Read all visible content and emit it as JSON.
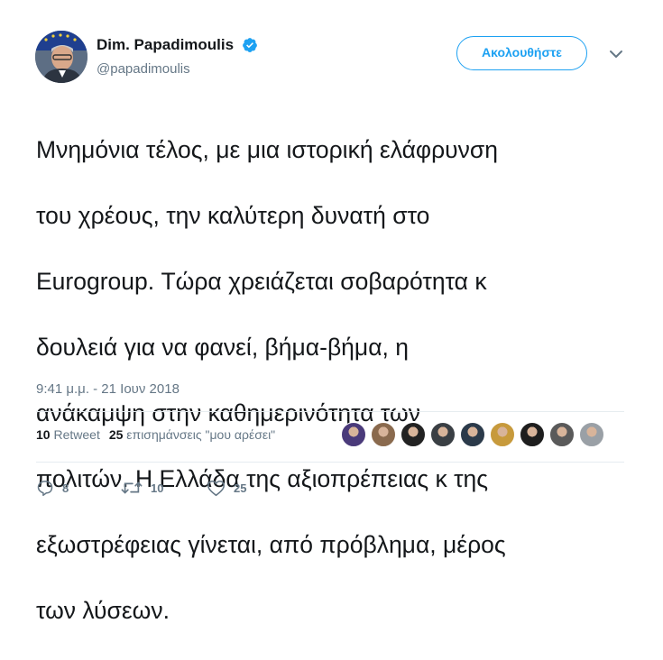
{
  "author": {
    "display_name": "Dim. Papadimoulis",
    "handle": "@papadimoulis",
    "avatar_icon": "profile-photo",
    "verified_icon": "verified-badge-icon",
    "verified_color": "#1da1f2"
  },
  "follow_button": {
    "label": "Ακολουθήστε",
    "color": "#1da1f2"
  },
  "more_menu_icon": "chevron-down-icon",
  "tweet": {
    "text_lines": [
      "Μνημόνια τέλος, με μια ιστορική ελάφρυνση",
      "του χρέους, την καλύτερη δυνατή στο",
      "Eurogroup. Τώρα χρειάζεται σοβαρότητα κ",
      "δουλειά για να φανεί, βήμα-βήμα, η",
      "ανάκαμψη στην καθημερινότητα των",
      "πολιτών. Η Ελλάδα της αξιοπρέπειας κ της",
      "εξωστρέφειας γίνεται, από πρόβλημα, μέρος",
      "των λύσεων."
    ],
    "timestamp": "9:41 μ.μ. - 21 Ιουν 2018"
  },
  "stats": {
    "retweets_count": "10",
    "retweets_label": "Retweet",
    "likes_count": "25",
    "likes_label": "επισημάνσεις \"μου αρέσει\""
  },
  "liker_avatars": [
    {
      "color": "#4a3a7a"
    },
    {
      "color": "#8a6a4e"
    },
    {
      "color": "#222222"
    },
    {
      "color": "#3a3f44"
    },
    {
      "color": "#2b3a4a"
    },
    {
      "color": "#c79a3c"
    },
    {
      "color": "#1e1e1e"
    },
    {
      "color": "#5a5a5a"
    },
    {
      "color": "#9aa0a6"
    }
  ],
  "actions": {
    "reply": {
      "icon": "reply-icon",
      "count": "8"
    },
    "retweet": {
      "icon": "retweet-icon",
      "count": "10"
    },
    "like": {
      "icon": "heart-icon",
      "count": "25"
    }
  },
  "colors": {
    "text_primary": "#14171a",
    "text_secondary": "#657786",
    "divider": "#e6ecf0"
  }
}
